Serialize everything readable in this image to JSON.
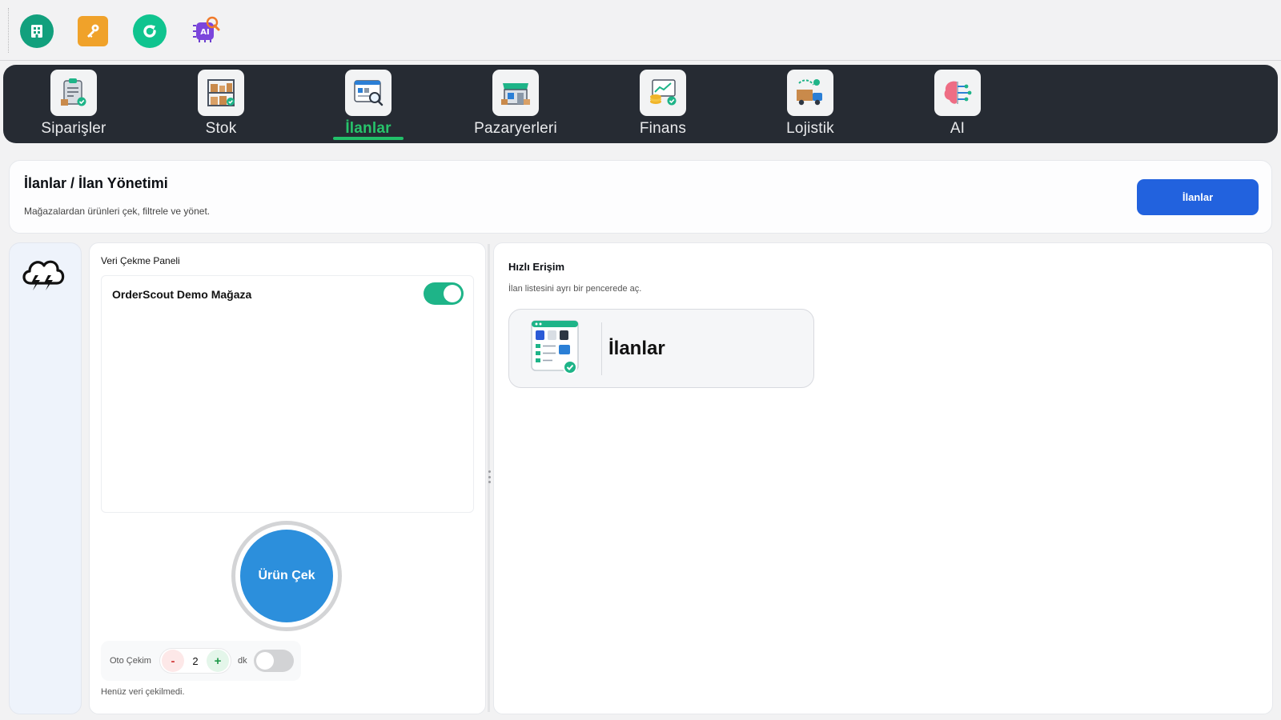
{
  "toolbar": {
    "icons": [
      "building-icon",
      "key-icon",
      "refresh-icon",
      "ai-chip-icon"
    ]
  },
  "nav": {
    "items": [
      {
        "label": "Siparişler",
        "icon": "orders-clipboard-icon"
      },
      {
        "label": "Stok",
        "icon": "stock-shelves-icon"
      },
      {
        "label": "İlanlar",
        "icon": "listings-search-icon",
        "active": true
      },
      {
        "label": "Pazaryerleri",
        "icon": "marketplace-store-icon"
      },
      {
        "label": "Finans",
        "icon": "finance-coins-icon"
      },
      {
        "label": "Lojistik",
        "icon": "logistics-truck-icon"
      },
      {
        "label": "AI",
        "icon": "ai-brain-icon"
      }
    ],
    "active_color": "#27c46b"
  },
  "header": {
    "title": "İlanlar / İlan Yönetimi",
    "subtitle": "Mağazalardan ürünleri çek, filtrele ve yönet.",
    "button_label": "İlanlar",
    "button_color": "#2262de"
  },
  "sidebar": {
    "icon": "cloud-lightning-icon"
  },
  "panel": {
    "title": "Veri Çekme Paneli",
    "store": {
      "name": "OrderScout Demo Mağaza",
      "enabled": true
    },
    "pull_button": "Ürün Çek",
    "auto": {
      "label": "Oto Çekim",
      "minus": "-",
      "value": "2",
      "plus": "+",
      "unit": "dk",
      "enabled": false
    },
    "status": "Henüz veri çekilmedi."
  },
  "quick": {
    "title": "Hızlı Erişim",
    "subtitle": "İlan listesini ayrı bir pencerede aç.",
    "card_label": "İlanlar",
    "card_icon": "listings-window-icon"
  }
}
